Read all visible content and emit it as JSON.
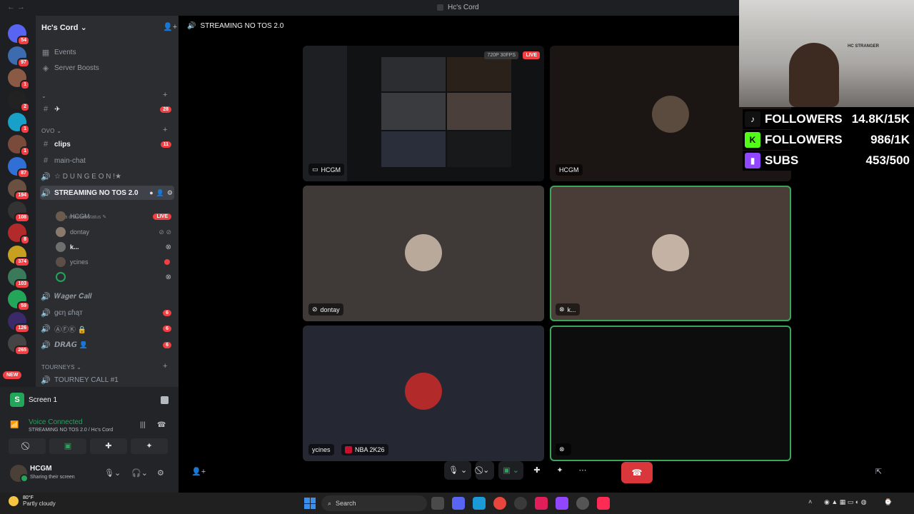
{
  "titlebar": {
    "title": "Hc's Cord",
    "nav": "← →"
  },
  "rail": {
    "servers": [
      {
        "badge": "54",
        "color": "#5865f2"
      },
      {
        "badge": "97",
        "color": "#3d6bb0"
      },
      {
        "badge": "1",
        "color": "#8a5a44"
      },
      {
        "badge": "2",
        "color": "#222222"
      },
      {
        "badge": "1",
        "color": "#18a0c8"
      },
      {
        "badge": "1",
        "color": "#7a4a3a"
      },
      {
        "badge": "87",
        "color": "#2f6fd6"
      },
      {
        "badge": "194",
        "color": "#6a5040"
      },
      {
        "badge": "108",
        "color": "#333333"
      },
      {
        "badge": "8",
        "color": "#b22a2a"
      },
      {
        "badge": "374",
        "color": "#c8a020"
      },
      {
        "badge": "103",
        "color": "#3a7a5a"
      },
      {
        "badge": "59",
        "color": "#23a55a"
      },
      {
        "badge": "126",
        "color": "#3a2a6a"
      },
      {
        "badge": "265",
        "color": "#444444"
      }
    ],
    "new_label": "NEW"
  },
  "server": {
    "name": "Hc's Cord"
  },
  "sidebar": {
    "events": "Events",
    "boosts": "Server Boosts",
    "cat_blank": "⌄",
    "chan_plane": "✈",
    "chan_plane_badge": "28",
    "cat_ovo": "OVO ⌄",
    "clips": "clips",
    "clips_badge": "11",
    "main_chat": "main-chat",
    "dungeon": "☆ D U N G E O N !★",
    "streaming": "STREAMING NO TOS 2.0",
    "status_hint": "Set a channel status ✎",
    "voice_users": [
      {
        "name": "HCGM",
        "live": "LIVE"
      },
      {
        "name": "dontay"
      },
      {
        "name": "k..."
      },
      {
        "name": "ycines"
      },
      {
        "name": ""
      }
    ],
    "wager": "𝑾𝒂𝒈𝒆𝒓 𝑪𝒂𝒍𝒍",
    "gen_chat": "ɡєη ɕɦąт",
    "gen_badge": "6",
    "afk": "ⒶⒻⓀ 🔒",
    "afk_badge": "6",
    "drag": "𝘿𝙍𝘼𝙂 👤",
    "drag_badge": "6",
    "cat_tourneys": "TOURNEYS ⌄",
    "tourney_call": "TOURNEY CALL #1"
  },
  "voice_panel": {
    "screen_label": "Screen 1",
    "screen_icon": "S",
    "connected": "Voice Connected",
    "channel_path": "STREAMING NO TOS 2.0 / Hc's Cord",
    "user_name": "HCGM",
    "user_status": "Sharing their screen"
  },
  "stage": {
    "channel": "STREAMING NO TOS 2.0",
    "tiles": {
      "t1": {
        "name": "HCGM",
        "quality": "720P 30FPS",
        "live": "LIVE"
      },
      "t2": {
        "name": "HCGM"
      },
      "t3": {
        "name": "dontay"
      },
      "t4": {
        "name": "k..."
      },
      "t5": {
        "name": "ycines",
        "game": "NBA 2K26"
      },
      "t6": {
        "name": ""
      }
    }
  },
  "overlay": {
    "stats": [
      {
        "label": "FOLLOWERS",
        "value": "14.8K/15K",
        "icon": "♪",
        "color": "#ffffff",
        "bg": "#111111"
      },
      {
        "label": "FOLLOWERS",
        "value": "986/1K",
        "icon": "K",
        "color": "#ffffff",
        "bg": "#53fc18"
      },
      {
        "label": "SUBS",
        "value": "453/500",
        "icon": "▮",
        "color": "#ffffff",
        "bg": "#9146ff"
      }
    ],
    "sign": "HC STRANGER"
  },
  "taskbar": {
    "temp": "80°F",
    "weather": "Partly cloudy",
    "search": "Search"
  },
  "colors": {
    "accent": "#5865f2",
    "green": "#23a55a",
    "red": "#f23f43"
  }
}
